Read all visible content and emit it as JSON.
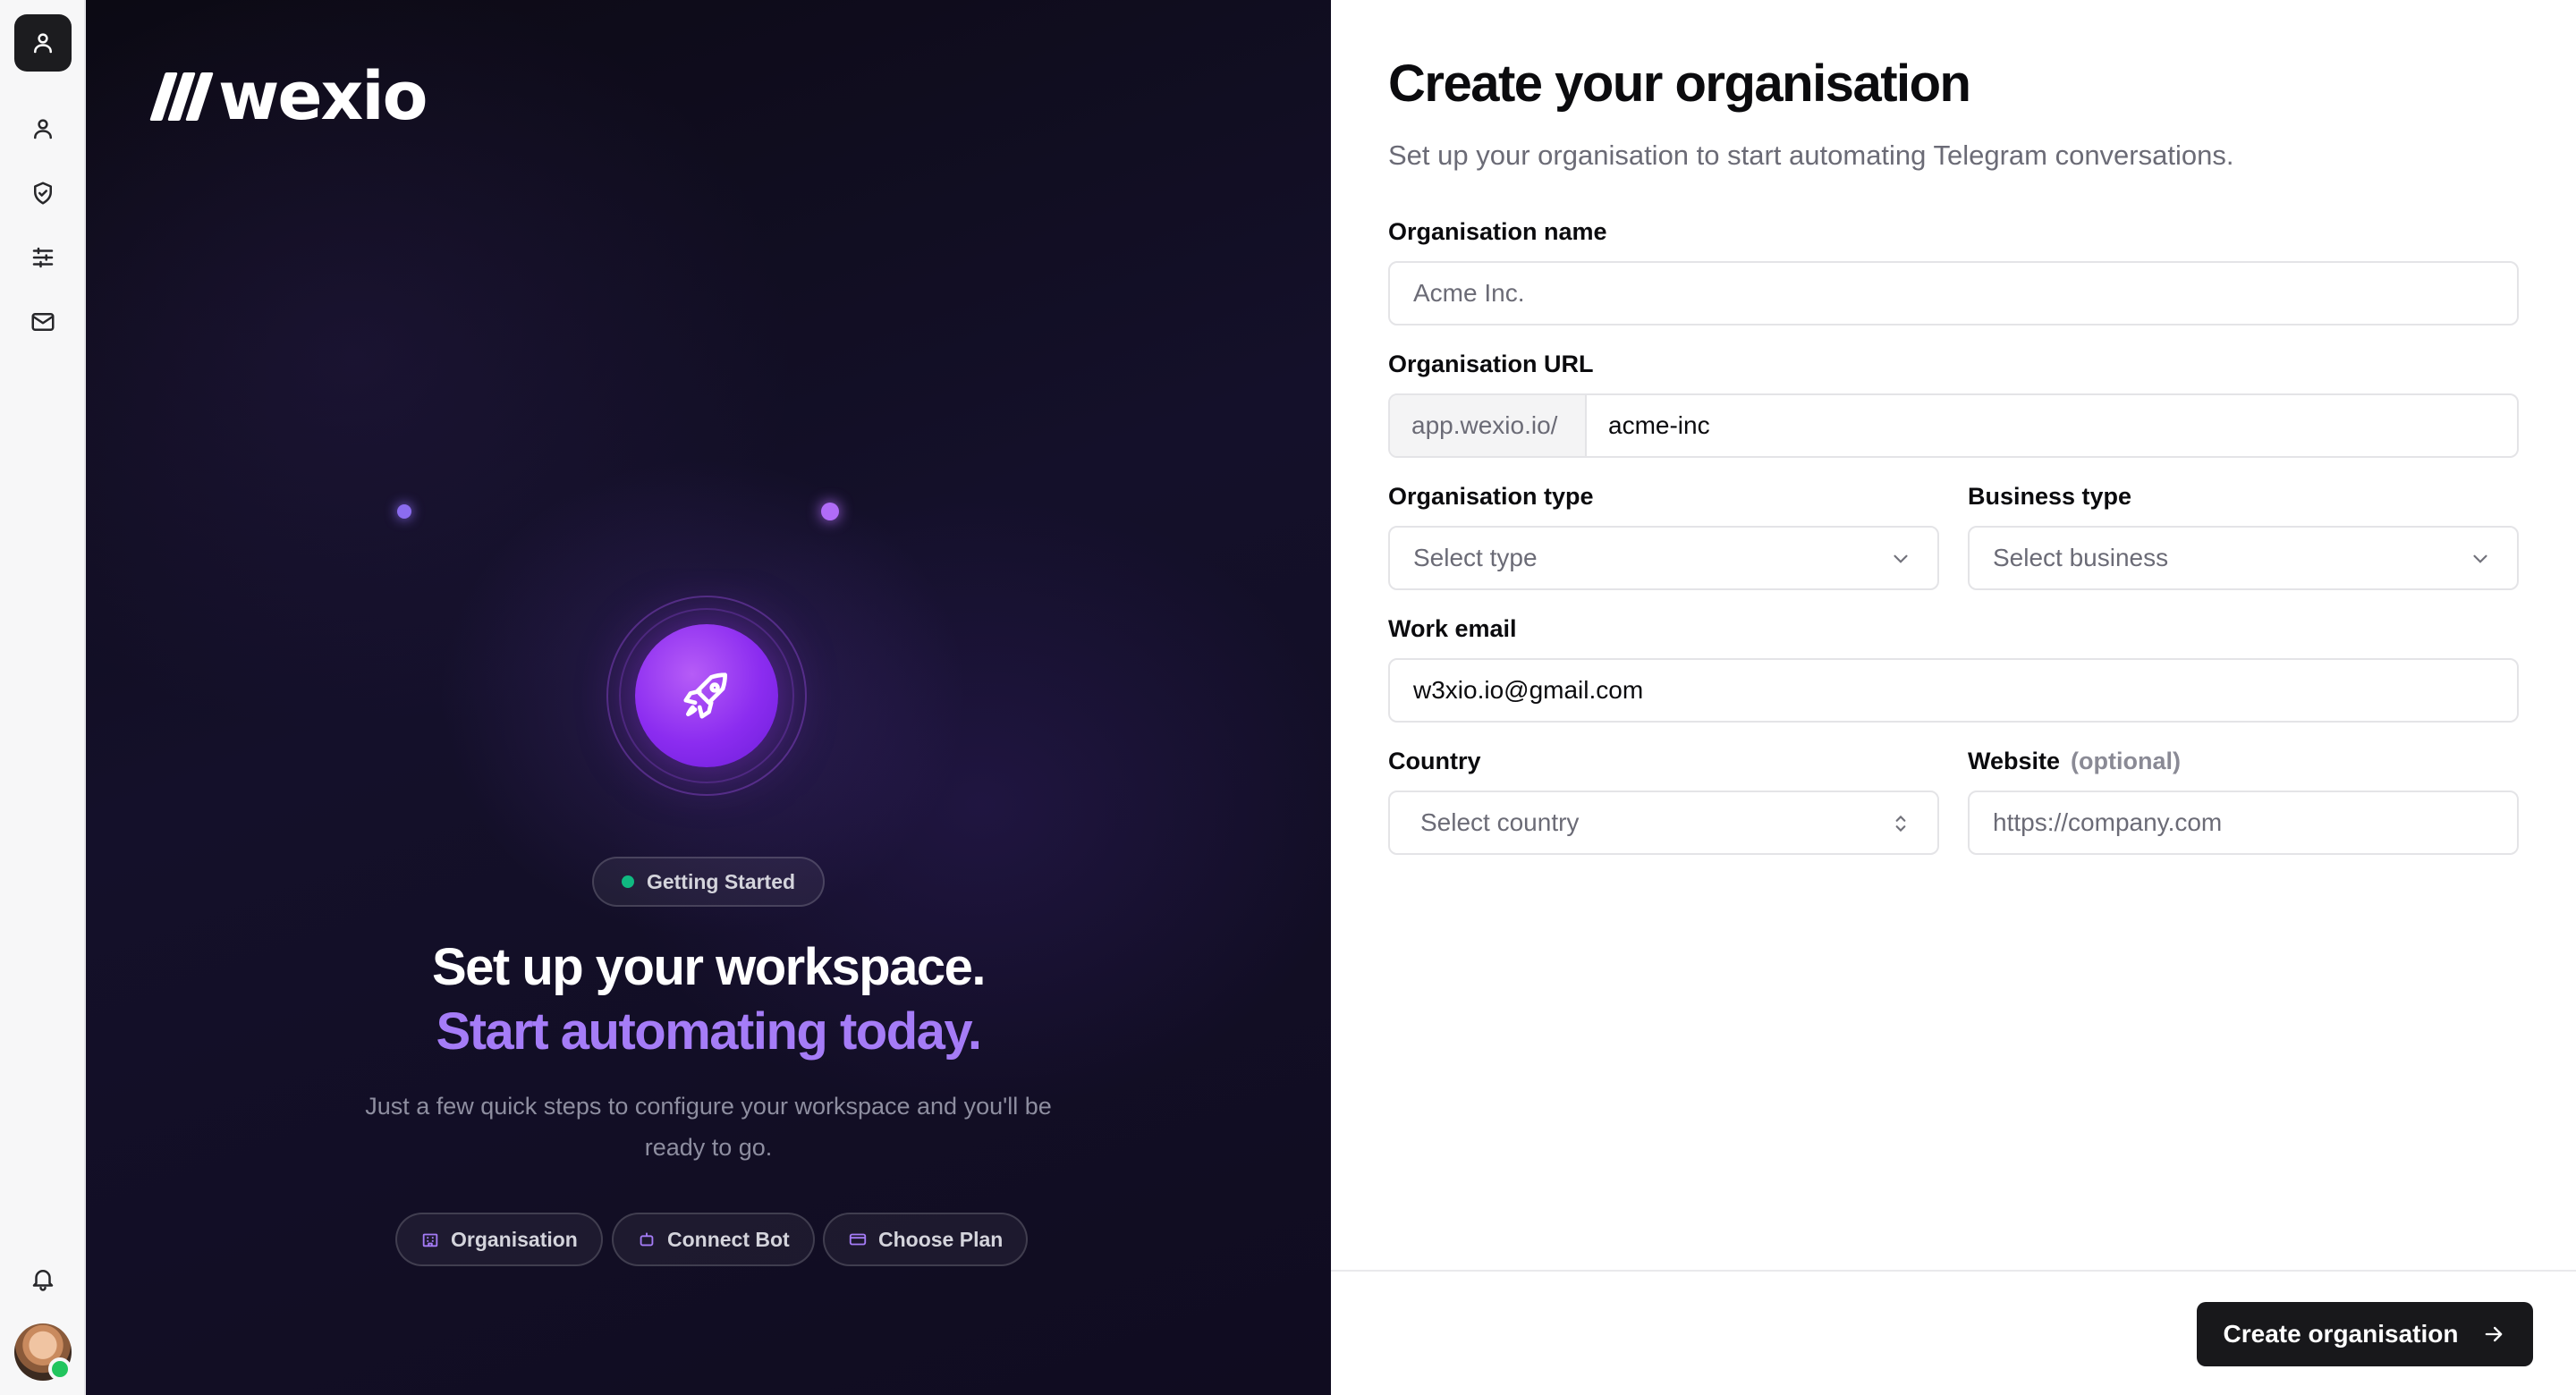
{
  "sidebar": {
    "items": [
      {
        "icon": "user-icon"
      },
      {
        "icon": "shield-check-icon"
      },
      {
        "icon": "sliders-icon"
      },
      {
        "icon": "mail-icon"
      }
    ],
    "bottom": [
      {
        "icon": "bell-icon"
      }
    ],
    "avatar_status": "online"
  },
  "hero": {
    "logo": "wexio",
    "badge": "Getting Started",
    "title_line1": "Set up your workspace.",
    "title_line2": "Start automating today.",
    "subtitle": "Just a few quick steps to configure your workspace and you'll be ready to go.",
    "steps": [
      {
        "label": "Organisation",
        "icon": "building-icon"
      },
      {
        "label": "Connect Bot",
        "icon": "bot-icon"
      },
      {
        "label": "Choose Plan",
        "icon": "credit-card-icon"
      }
    ],
    "colors": {
      "accent": "#a57cf7",
      "badge_dot": "#10b981"
    }
  },
  "form": {
    "title": "Create your organisation",
    "subtitle": "Set up your organisation to start automating Telegram conversations.",
    "org_name": {
      "label": "Organisation name",
      "placeholder": "Acme Inc."
    },
    "org_url": {
      "label": "Organisation URL",
      "prefix": "app.wexio.io/",
      "value": "acme-inc"
    },
    "org_type": {
      "label": "Organisation type",
      "placeholder": "Select type"
    },
    "business_type": {
      "label": "Business type",
      "placeholder": "Select business"
    },
    "work_email": {
      "label": "Work email",
      "value": "w3xio.io@gmail.com"
    },
    "country": {
      "label": "Country",
      "placeholder": "Select country"
    },
    "website": {
      "label": "Website",
      "optional": "(optional)",
      "placeholder": "https://company.com"
    },
    "submit": "Create organisation"
  }
}
